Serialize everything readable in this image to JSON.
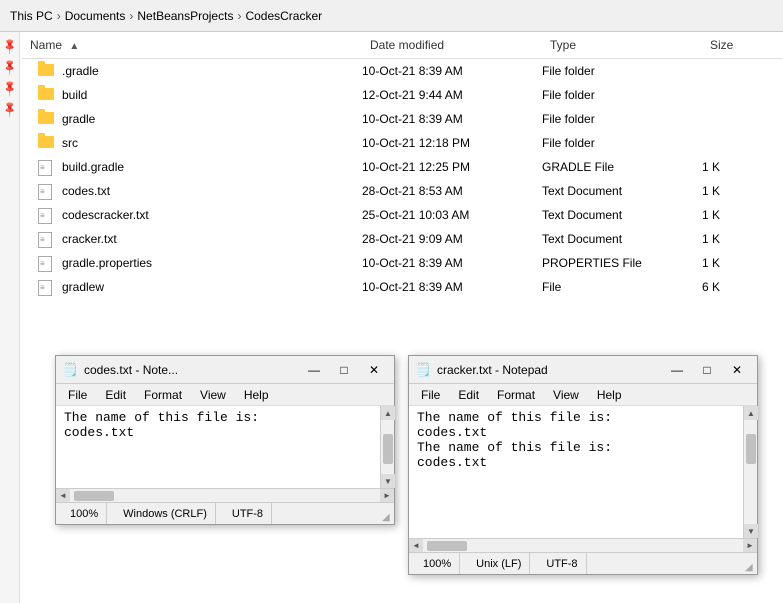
{
  "breadcrumb": {
    "items": [
      "This PC",
      "Documents",
      "NetBeansProjects",
      "CodesCracker"
    ]
  },
  "columns": {
    "name": "Name",
    "date": "Date modified",
    "type": "Type",
    "size": "Size"
  },
  "files": [
    {
      "name": ".gradle",
      "date": "10-Oct-21 8:39 AM",
      "type": "File folder",
      "size": ""
    },
    {
      "name": "build",
      "date": "12-Oct-21 9:44 AM",
      "type": "File folder",
      "size": ""
    },
    {
      "name": "gradle",
      "date": "10-Oct-21 8:39 AM",
      "type": "File folder",
      "size": ""
    },
    {
      "name": "src",
      "date": "10-Oct-21 12:18 PM",
      "type": "File folder",
      "size": ""
    },
    {
      "name": "build.gradle",
      "date": "10-Oct-21 12:25 PM",
      "type": "GRADLE File",
      "size": "1 K"
    },
    {
      "name": "codes.txt",
      "date": "28-Oct-21 8:53 AM",
      "type": "Text Document",
      "size": "1 K"
    },
    {
      "name": "codescracker.txt",
      "date": "25-Oct-21 10:03 AM",
      "type": "Text Document",
      "size": "1 K"
    },
    {
      "name": "cracker.txt",
      "date": "28-Oct-21 9:09 AM",
      "type": "Text Document",
      "size": "1 K"
    },
    {
      "name": "gradle.properties",
      "date": "10-Oct-21 8:39 AM",
      "type": "PROPERTIES File",
      "size": "1 K"
    },
    {
      "name": "gradlew",
      "date": "10-Oct-21 8:39 AM",
      "type": "File",
      "size": "6 K"
    }
  ],
  "pins": [
    "📌",
    "📌",
    "📌",
    "📌"
  ],
  "notepad1": {
    "title": "codes.txt - Note...",
    "icon": "📄",
    "menu": [
      "File",
      "Edit",
      "Format",
      "View",
      "Help"
    ],
    "content_lines": [
      "The name of this file is:",
      "     codes.txt"
    ],
    "statusbar": {
      "zoom": "100%",
      "line_ending": "Windows (CRLF)",
      "encoding": "UTF-8"
    }
  },
  "notepad2": {
    "title": "cracker.txt - Notepad",
    "icon": "📄",
    "menu": [
      "File",
      "Edit",
      "Format",
      "View",
      "Help"
    ],
    "content_lines": [
      "The name of this file is:",
      "     codes.txt",
      "The name of this file is:",
      "     codes.txt"
    ],
    "statusbar": {
      "zoom": "100%",
      "line_ending": "Unix (LF)",
      "encoding": "UTF-8"
    }
  }
}
